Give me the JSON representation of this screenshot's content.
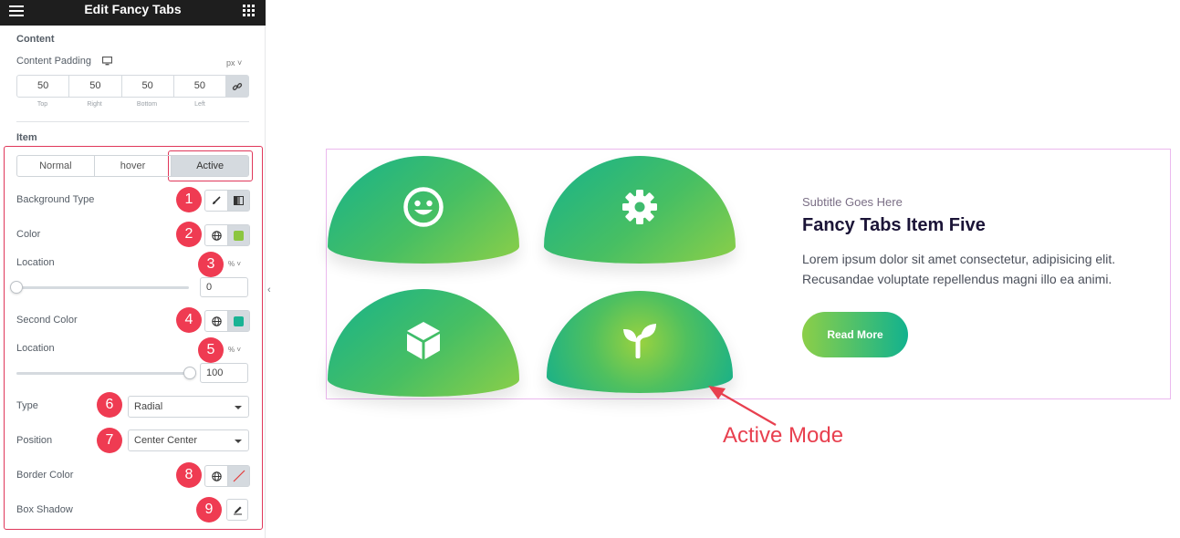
{
  "panel": {
    "title": "Edit Fancy Tabs",
    "content_section": "Content",
    "content_padding_label": "Content Padding",
    "padding_unit": "px",
    "padding": [
      {
        "value": "50",
        "label": "Top"
      },
      {
        "value": "50",
        "label": "Right"
      },
      {
        "value": "50",
        "label": "Bottom"
      },
      {
        "value": "50",
        "label": "Left"
      }
    ],
    "item_section": "Item",
    "tabs": [
      "Normal",
      "hover",
      "Active"
    ],
    "active_tab": "Active",
    "controls": {
      "background_type": "Background Type",
      "color": "Color",
      "color_swatch": "#8cc63f",
      "location1": "Location",
      "location1_unit": "%",
      "location1_value": "0",
      "second_color": "Second Color",
      "second_color_swatch": "#19b394",
      "location2": "Location",
      "location2_unit": "%",
      "location2_value": "100",
      "type_label": "Type",
      "type_value": "Radial",
      "position_label": "Position",
      "position_value": "Center Center",
      "border_color": "Border Color",
      "box_shadow": "Box Shadow"
    },
    "badges": [
      "1",
      "2",
      "3",
      "4",
      "5",
      "6",
      "7",
      "8",
      "9"
    ]
  },
  "preview": {
    "tab_icons": [
      "smile-icon",
      "gear-icon",
      "cube-icon",
      "sprout-icon"
    ],
    "subtitle": "Subtitle Goes Here",
    "heading": "Fancy Tabs Item Five",
    "description": "Lorem ipsum dolor sit amet consectetur, adipisicing elit. Recusandae voluptate repellendus magni illo ea animi.",
    "button": "Read More",
    "annotation": "Active Mode",
    "accent_start": "#16b28c",
    "accent_end": "#8ccf48"
  }
}
